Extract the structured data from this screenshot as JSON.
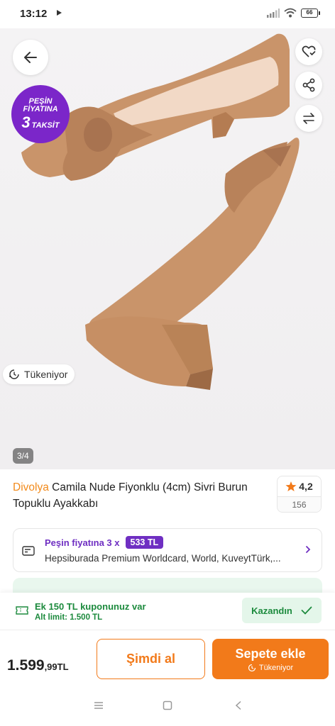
{
  "status_bar": {
    "time": "13:12",
    "battery": "66"
  },
  "hero": {
    "promo_badge": {
      "line1": "PEŞİN",
      "line2": "FİYATINA",
      "number": "3",
      "suffix": "TAKSİT"
    },
    "stock_chip": {
      "label": "Tükeniyor"
    },
    "page_indicator": "3/4",
    "icons": [
      "arrow-left-icon",
      "heart-check-icon",
      "share-icon",
      "compare-arrows-icon"
    ]
  },
  "product": {
    "brand": "Divolya",
    "name": " Camila Nude Fiyonklu (4cm) Sivri Burun Topuklu Ayakkabı",
    "rating": "4,2",
    "rating_count": "156"
  },
  "installment": {
    "label": "Peşin fiyatına 3 x",
    "amount": "533 TL",
    "cards": "Hepsiburada Premium Worldcard, World, KuveytTürk,..."
  },
  "coupon": {
    "title": "Ek 150 TL kuponunuz var",
    "limit": "Alt limit: 1.500 TL",
    "button": "Kazandın"
  },
  "buy_bar": {
    "price_main": "1.599",
    "price_sub": ",99TL",
    "buy_now": "Şimdi al",
    "add_to_cart": "Sepete ekle",
    "add_to_cart_sub": "Tükeniyor"
  },
  "colors": {
    "brand": "#f27a1a",
    "promo": "#7b26c9",
    "success": "#1c8a3d"
  }
}
